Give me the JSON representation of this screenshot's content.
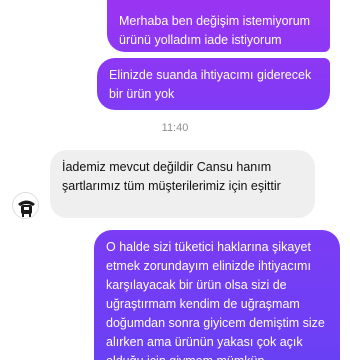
{
  "colors": {
    "outgoing_bubble_gradient": [
      "#9b34f3",
      "#6f3ff5"
    ],
    "incoming_bubble": "#efefef",
    "timestamp_text": "#8e8e8e"
  },
  "messages": [
    {
      "direction": "outgoing",
      "text": "Merhaba ben değişim istemiyorum ürünü yolladım iade istiyorum"
    },
    {
      "direction": "outgoing",
      "text": "Elinizde suanda ihtiyacımı giderecek bir ürün yok"
    },
    {
      "direction": "incoming",
      "text": "İademiz mevcut değildir Cansu hanım şartlarımız tüm müşterilerimiz için eşittir"
    },
    {
      "direction": "outgoing",
      "text": "O halde sizi tüketici haklarına şikayet etmek zorundayım elinizde ihtiyacımı karşılayacak bir ürün olsa sizi de uğraştırmam kendim de uğraşmam doğumdan sonra giyicem demiştim size alırken ama ürünün yakası çok açık olduğu için giymem mümkün"
    }
  ],
  "timestamp": "11:40",
  "avatar": {
    "icon": "store-logo-icon"
  }
}
